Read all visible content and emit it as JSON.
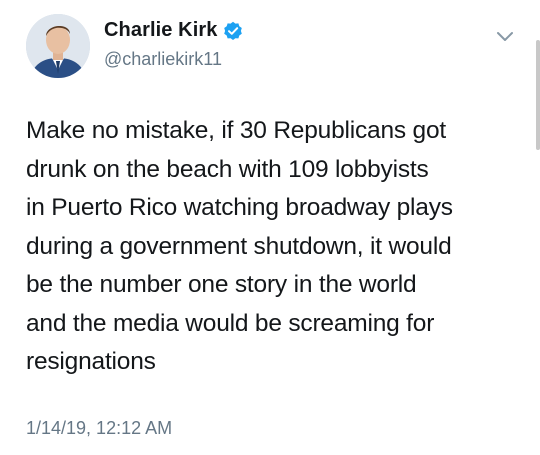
{
  "tweet": {
    "display_name": "Charlie Kirk",
    "handle": "@charliekirk11",
    "verified": true,
    "text": "Make no mistake, if 30 Republicans got\ndrunk on the beach with 109 lobbyists\nin Puerto Rico watching broadway plays\nduring a government shutdown, it would\nbe the number one story in the world\nand the media would be screaming for\nresignations",
    "timestamp": "1/14/19, 12:12 AM"
  },
  "icons": {
    "verified": "verified-badge-icon",
    "menu": "chevron-down-icon"
  },
  "colors": {
    "text": "#14171a",
    "secondary": "#657786",
    "verified_blue": "#1da1f2",
    "background": "#ffffff"
  }
}
